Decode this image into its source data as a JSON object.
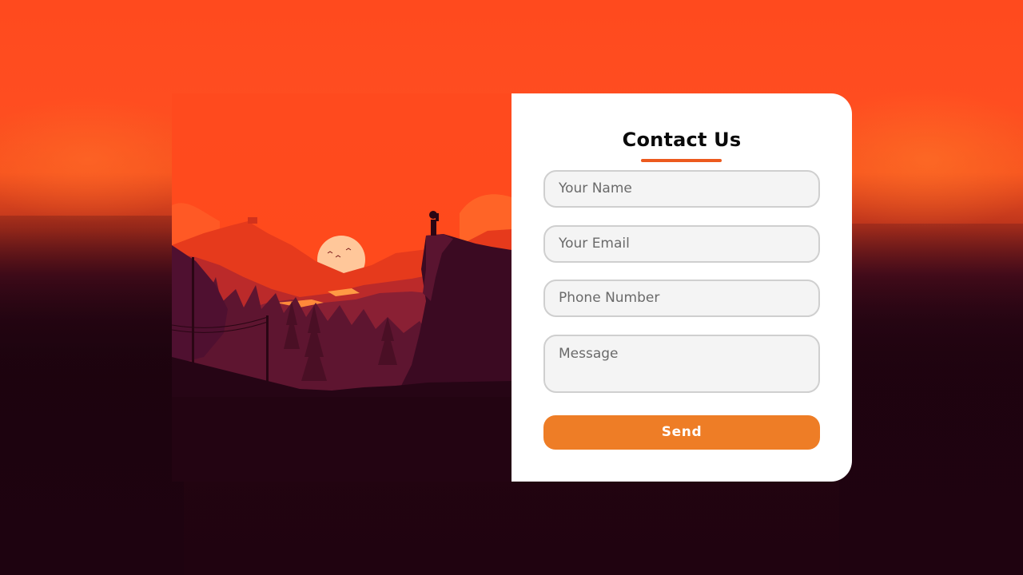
{
  "contact_form": {
    "title": "Contact Us",
    "name_placeholder": "Your Name",
    "email_placeholder": "Your Email",
    "phone_placeholder": "Phone Number",
    "message_placeholder": "Message",
    "send_label": "Send"
  },
  "colors": {
    "accent": "#ee7d26",
    "title_underline": "#ec5a1e",
    "sky_top": "#ff4a1e",
    "dark_background": "#200310"
  }
}
